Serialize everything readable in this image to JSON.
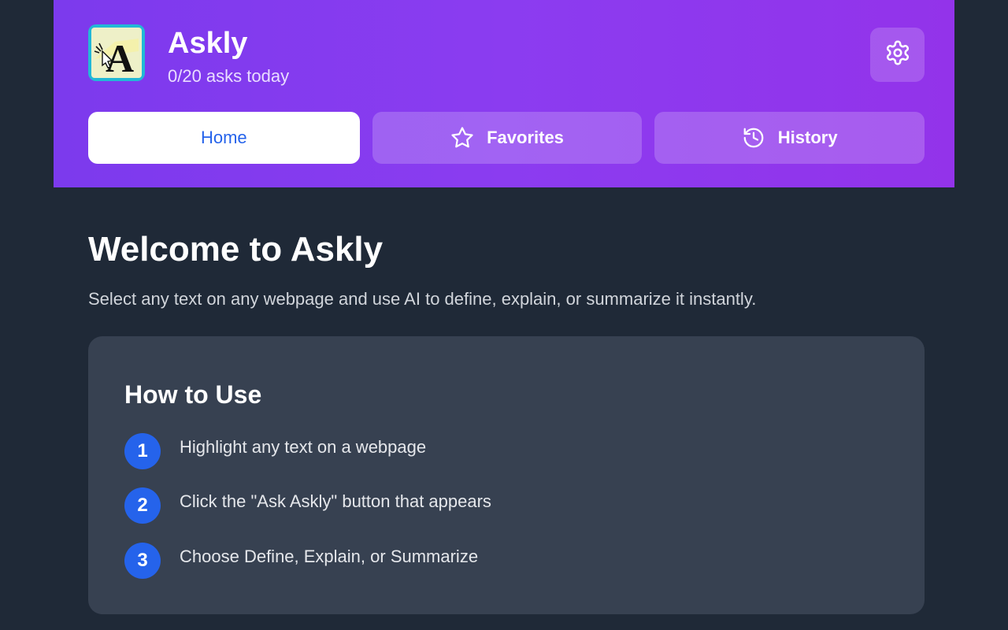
{
  "app": {
    "title": "Askly",
    "subtitle": "0/20 asks today",
    "logo_letter": "A"
  },
  "icons": {
    "logo": "askly-logo",
    "settings": "gear-icon",
    "favorites": "star-icon",
    "history": "history-icon"
  },
  "tabs": [
    {
      "label": "Home",
      "active": true
    },
    {
      "label": "Favorites",
      "active": false,
      "icon": "star-icon"
    },
    {
      "label": "History",
      "active": false,
      "icon": "history-icon"
    }
  ],
  "welcome": {
    "title": "Welcome to Askly",
    "description": "Select any text on any webpage and use AI to define, explain, or summarize it instantly."
  },
  "how_to": {
    "title": "How to Use",
    "steps": [
      {
        "number": "1",
        "text": "Highlight any text on a webpage"
      },
      {
        "number": "2",
        "text": "Click the \"Ask Askly\" button that appears"
      },
      {
        "number": "3",
        "text": "Choose Define, Explain, or Summarize"
      }
    ]
  },
  "colors": {
    "header_gradient_start": "#7c3aed",
    "header_gradient_end": "#9333ea",
    "background": "#1f2937",
    "card": "#374151",
    "accent_blue": "#2563eb"
  }
}
